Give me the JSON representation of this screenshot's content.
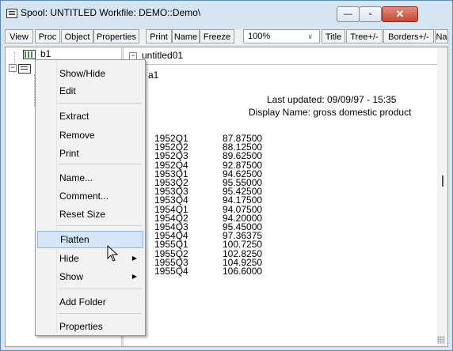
{
  "window": {
    "title": "Spool: UNTITLED   Workfile: DEMO::Demo\\",
    "min_glyph": "—",
    "max_glyph": "▫",
    "close_glyph": "✕"
  },
  "toolbar": {
    "view": "View",
    "proc": "Proc",
    "object": "Object",
    "properties": "Properties",
    "print": "Print",
    "name": "Name",
    "freeze": "Freeze",
    "zoom": "100%",
    "title": "Title",
    "tree": "Tree+/-",
    "borders": "Borders+/-",
    "na": "Na"
  },
  "tree": {
    "item1": "b1",
    "expand_glyph": "−"
  },
  "right": {
    "header": "untitled01",
    "header_glyph": "−",
    "series_name": "a1",
    "last_updated": "Last updated: 09/09/97 - 15:35",
    "display_name": "Display Name: gross domestic product"
  },
  "observations": [
    {
      "date": "1952Q1",
      "value": "87.87500"
    },
    {
      "date": "1952Q2",
      "value": "88.12500"
    },
    {
      "date": "1952Q3",
      "value": "89.62500"
    },
    {
      "date": "1952Q4",
      "value": "92.87500"
    },
    {
      "date": "1953Q1",
      "value": "94.62500"
    },
    {
      "date": "1953Q2",
      "value": "95.55000"
    },
    {
      "date": "1953Q3",
      "value": "95.42500"
    },
    {
      "date": "1953Q4",
      "value": "94.17500"
    },
    {
      "date": "1954Q1",
      "value": "94.07500"
    },
    {
      "date": "1954Q2",
      "value": "94.20000"
    },
    {
      "date": "1954Q3",
      "value": "95.45000"
    },
    {
      "date": "1954Q4",
      "value": "97.36375"
    },
    {
      "date": "1955Q1",
      "value": "100.7250"
    },
    {
      "date": "1955Q2",
      "value": "102.8250"
    },
    {
      "date": "1955Q3",
      "value": "104.9250"
    },
    {
      "date": "1955Q4",
      "value": "106.6000"
    }
  ],
  "context_menu": {
    "show_hide": "Show/Hide",
    "edit": "Edit",
    "extract": "Extract",
    "remove": "Remove",
    "print": "Print",
    "name": "Name...",
    "comment": "Comment...",
    "reset_size": "Reset Size",
    "flatten": "Flatten",
    "hide": "Hide",
    "show": "Show",
    "add_folder": "Add Folder",
    "properties": "Properties",
    "submenu_arrow": "▶"
  }
}
